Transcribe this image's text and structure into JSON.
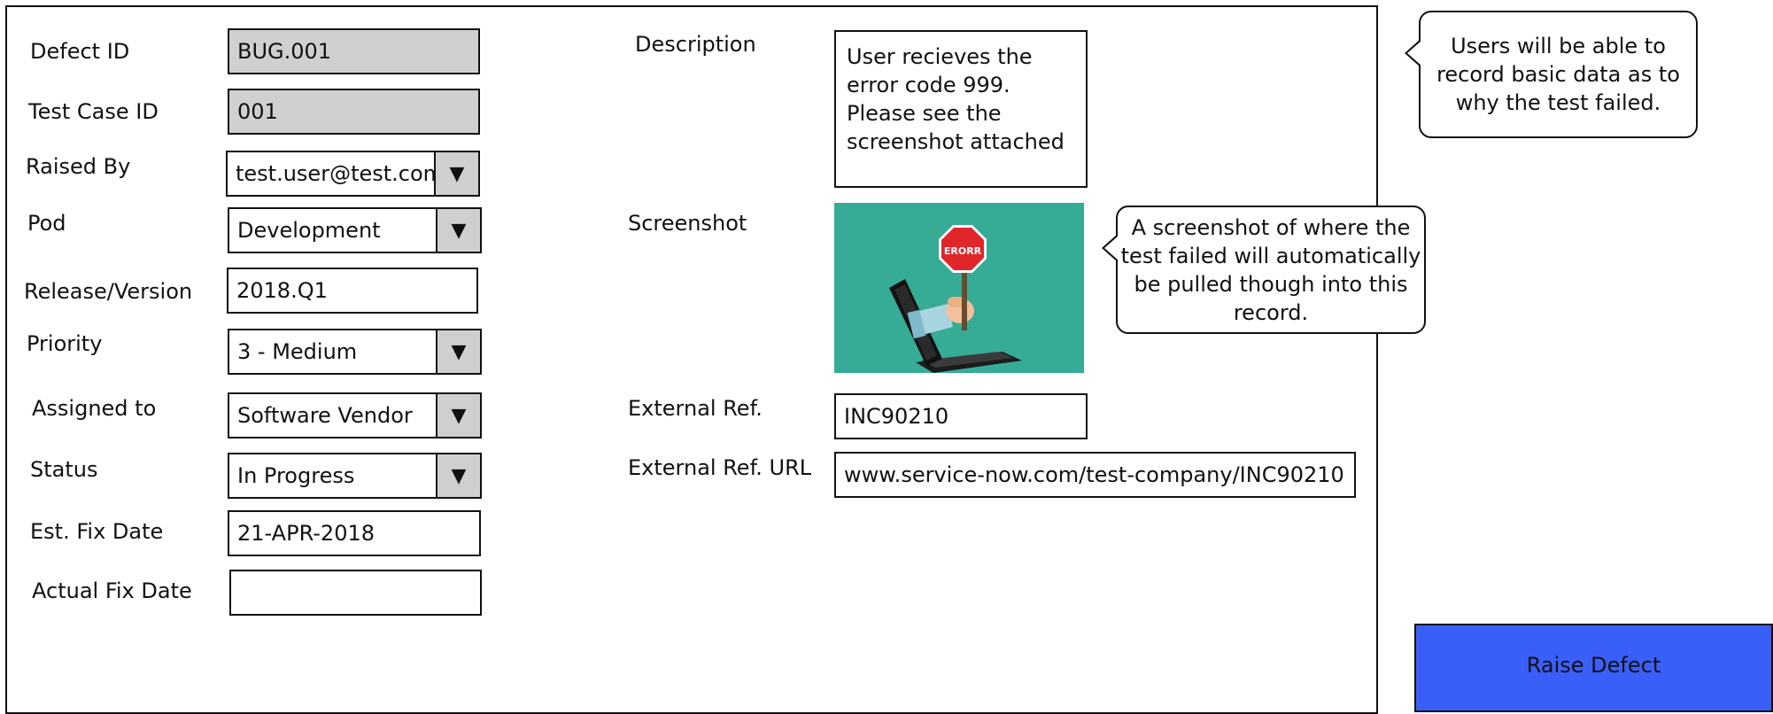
{
  "form": {
    "defect_id": {
      "label": "Defect ID",
      "value": "BUG.001"
    },
    "test_case_id": {
      "label": "Test Case ID",
      "value": "001"
    },
    "raised_by": {
      "label": "Raised By",
      "value": "test.user@test.com"
    },
    "pod": {
      "label": "Pod",
      "value": "Development"
    },
    "release_version": {
      "label": "Release/Version",
      "value": "2018.Q1"
    },
    "priority": {
      "label": "Priority",
      "value": "3 - Medium"
    },
    "assigned_to": {
      "label": "Assigned to",
      "value": "Software Vendor"
    },
    "status": {
      "label": "Status",
      "value": "In Progress"
    },
    "est_fix_date": {
      "label": "Est. Fix Date",
      "value": "21-APR-2018"
    },
    "actual_fix_date": {
      "label": "Actual Fix Date",
      "value": ""
    },
    "description": {
      "label": "Description",
      "value": "User recieves the\nerror code 999.\nPlease see the\nscreenshot attached"
    },
    "screenshot": {
      "label": "Screenshot",
      "sign_text": "ERORR"
    },
    "external_ref": {
      "label": "External Ref.",
      "value": "INC90210"
    },
    "external_ref_url": {
      "label": "External Ref. URL",
      "value": "www.service-now.com/test-company/INC90210"
    }
  },
  "notes": {
    "basic_data": "Users will be able to\nrecord basic data as to\nwhy the test failed.",
    "screenshot": "A screenshot of where the\ntest failed will automatically\nbe pulled though into this\nrecord."
  },
  "actions": {
    "raise_defect": "Raise Defect"
  },
  "icons": {
    "dropdown": "dropdown-arrow-icon"
  },
  "colors": {
    "readonly_bg": "#d0d0d0",
    "screenshot_bg": "#36ab95",
    "button_bg": "#3a5ff9",
    "stop_sign": "#e0262a"
  }
}
